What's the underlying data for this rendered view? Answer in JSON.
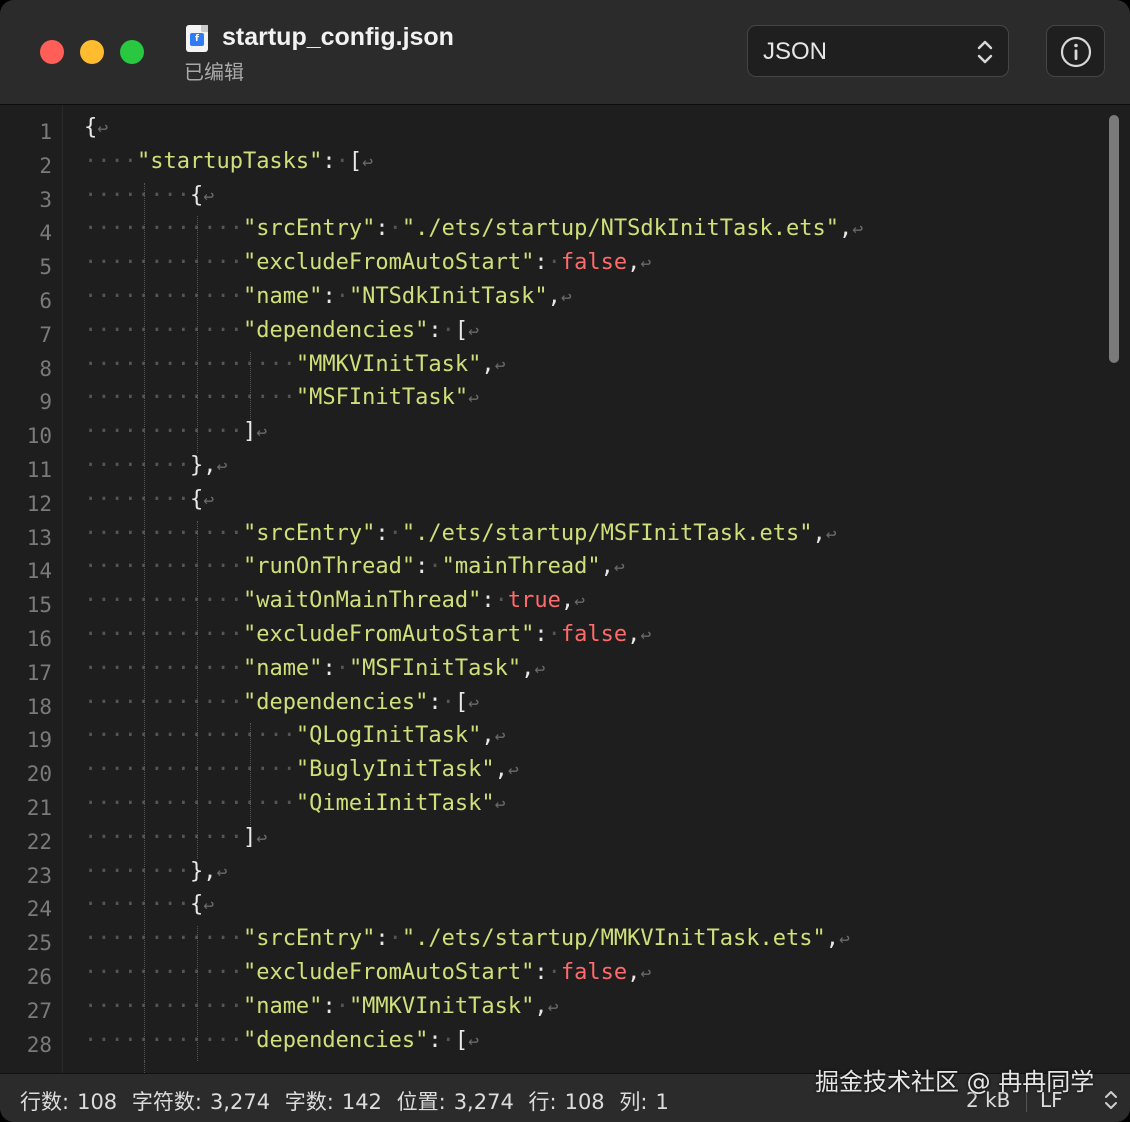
{
  "window": {
    "filename": "startup_config.json",
    "subtitle": "已编辑",
    "language": "JSON",
    "file_icon_glyph": "f"
  },
  "editor": {
    "lines": [
      "{",
      "    \"startupTasks\": [",
      "        {",
      "            \"srcEntry\": \"./ets/startup/NTSdkInitTask.ets\",",
      "            \"excludeFromAutoStart\": false,",
      "            \"name\": \"NTSdkInitTask\",",
      "            \"dependencies\": [",
      "                \"MMKVInitTask\",",
      "                \"MSFInitTask\"",
      "            ]",
      "        },",
      "        {",
      "            \"srcEntry\": \"./ets/startup/MSFInitTask.ets\",",
      "            \"runOnThread\": \"mainThread\",",
      "            \"waitOnMainThread\": true,",
      "            \"excludeFromAutoStart\": false,",
      "            \"name\": \"MSFInitTask\",",
      "            \"dependencies\": [",
      "                \"QLogInitTask\",",
      "                \"BuglyInitTask\",",
      "                \"QimeiInitTask\"",
      "            ]",
      "        },",
      "        {",
      "            \"srcEntry\": \"./ets/startup/MMKVInitTask.ets\",",
      "            \"excludeFromAutoStart\": false,",
      "            \"name\": \"MMKVInitTask\",",
      "            \"dependencies\": ["
    ],
    "scroll_fraction": 0.26
  },
  "status": {
    "lines_label": "行数:",
    "lines_value": "108",
    "chars_label": "字符数:",
    "chars_value": "3,274",
    "words_label": "字数:",
    "words_value": "142",
    "pos_label": "位置:",
    "pos_value": "3,274",
    "row_label": "行:",
    "row_value": "108",
    "col_label": "列:",
    "col_value": "1",
    "size": "2 kB",
    "line_ending": "LF"
  },
  "watermark": "掘金技术社区 @ 冉冉同学",
  "colors": {
    "string": "#cfe07a",
    "boolean": "#ff6b6b",
    "whitespace": "#555555",
    "line_number": "#7a7a7a"
  }
}
